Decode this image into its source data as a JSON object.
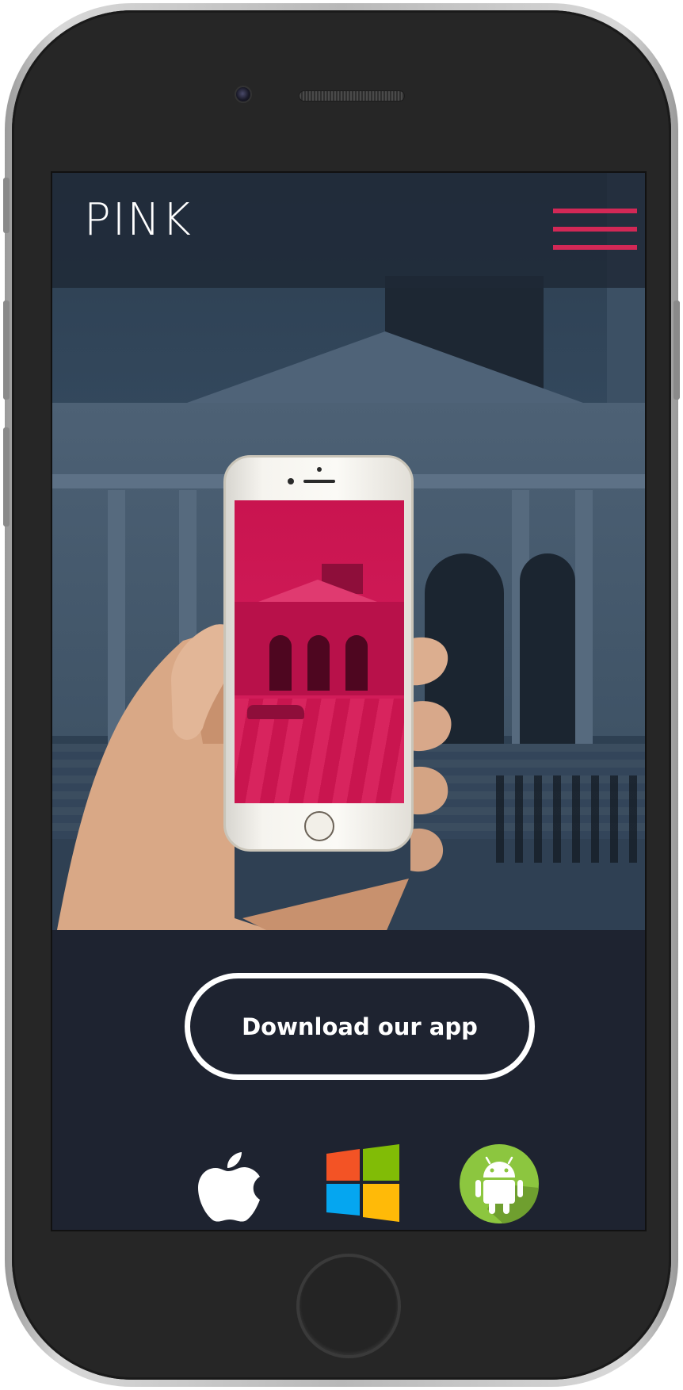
{
  "header": {
    "logo": "PINK",
    "menu_icon": "hamburger-menu-icon",
    "menu_color": "#d22856"
  },
  "hero": {
    "image": "hand-holding-phone-photo",
    "inner_screen_color": "#cf1a57",
    "overlay_color": "#2c3e50"
  },
  "download": {
    "button_label": "Download our app"
  },
  "platforms": [
    {
      "name": "apple",
      "icon": "apple-logo-icon"
    },
    {
      "name": "windows",
      "icon": "windows-logo-icon"
    },
    {
      "name": "android",
      "icon": "android-logo-icon"
    }
  ],
  "theme": {
    "background": "#1e2330",
    "accent": "#d22856",
    "device_frame": "#262626"
  }
}
